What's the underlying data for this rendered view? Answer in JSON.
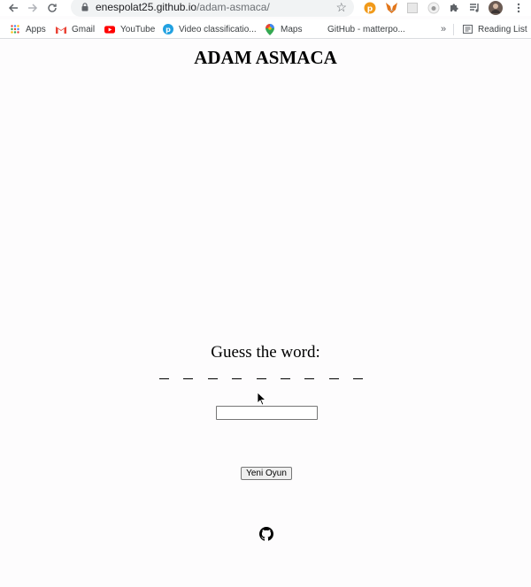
{
  "browser": {
    "url_host": "enespolat25.github.io",
    "url_path": "/adam-asmaca/"
  },
  "bookmarks": {
    "apps": "Apps",
    "gmail": "Gmail",
    "youtube": "YouTube",
    "video": "Video classificatio...",
    "maps": "Maps",
    "github": "GitHub - matterpo...",
    "more": "»",
    "reading_list": "Reading List"
  },
  "game": {
    "title": "ADAM ASMACA",
    "prompt": "Guess the word:",
    "blank_count": 9,
    "guess_value": "",
    "new_game_label": "Yeni Oyun"
  },
  "icons": {
    "github": "github-icon"
  },
  "colors": {
    "page_background": "#fdfcfd",
    "text": "#000000",
    "gmail_red": "#ea4335",
    "youtube_red": "#ff0000",
    "metamask_orange": "#e2761b"
  }
}
